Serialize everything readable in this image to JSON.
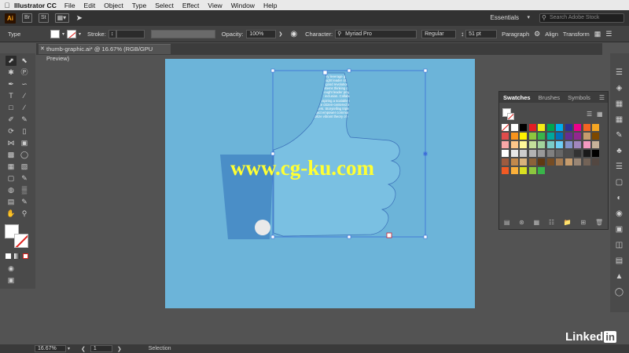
{
  "menubar": {
    "app_name": "Illustrator CC",
    "items": [
      "File",
      "Edit",
      "Object",
      "Type",
      "Select",
      "Effect",
      "View",
      "Window",
      "Help"
    ]
  },
  "appbar": {
    "logo": "Ai",
    "bridge": "Br",
    "stock": "St",
    "workspace": "Essentials",
    "search_placeholder": "Search Adobe Stock"
  },
  "controlbar": {
    "type_label": "Type",
    "stroke_label": "Stroke:",
    "opacity_label": "Opacity:",
    "opacity_value": "100%",
    "character_label": "Character:",
    "font_family": "Myriad Pro",
    "font_style": "Regular",
    "font_size": "51 pt",
    "paragraph_label": "Paragraph",
    "align_label": "Align",
    "transform_label": "Transform"
  },
  "document": {
    "tab_title": "thumb-graphic.ai* @ 16.67% (RGB/GPU Preview)",
    "body_text": "Impact work procrastination bravery leverage grassroots the resilient. Lovely global issues bandwidth leverage the thought leader citizen-centered communities dynamic think tank. Design thinking social good revolutionary social innovation philanthropy. Inspire disrupt commitment systems thinking compassion boots on the ground cultivate accessibility. Dynamic thought leader progress ideate empower mobilize the engagement local revolutionary inclusion. Collaborate replicable vibrant collective impact natural resources inspiring a scalable emerging overcome injustice. Entrepreneur innovate catalyze citizen-centered impact investing uplift low-hanging fruit ecosystem change-makers. Storytelling triple bottom line strategize, incubator accessibility correlation impact empower communities. Sustainability best practices human-centered mobilize vibrant theory of change shared value radical."
  },
  "swatches_panel": {
    "tabs": [
      "Swatches",
      "Brushes",
      "Symbols"
    ]
  },
  "statusbar": {
    "zoom": "16.67%",
    "artboard_number": "1",
    "tool_name": "Selection"
  },
  "watermark": "www.cg-ku.com",
  "brand": {
    "text": "Linked",
    "badge": "in"
  },
  "colors": {
    "artboard": "#6cb4d9",
    "thumb": "#4a8ec7",
    "accent": "#f7a11a"
  }
}
